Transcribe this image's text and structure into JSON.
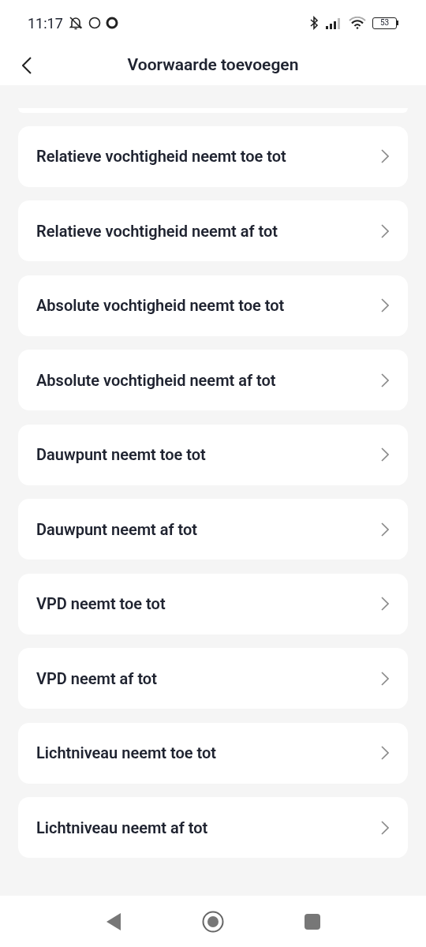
{
  "status_bar": {
    "time": "11:17",
    "battery": "53"
  },
  "header": {
    "title": "Voorwaarde toevoegen"
  },
  "conditions": [
    {
      "label": "Relatieve vochtigheid neemt toe tot"
    },
    {
      "label": "Relatieve vochtigheid neemt af tot"
    },
    {
      "label": "Absolute vochtigheid neemt toe tot"
    },
    {
      "label": "Absolute vochtigheid neemt af tot"
    },
    {
      "label": "Dauwpunt neemt toe tot"
    },
    {
      "label": "Dauwpunt neemt af tot"
    },
    {
      "label": "VPD neemt toe tot"
    },
    {
      "label": "VPD neemt af tot"
    },
    {
      "label": "Lichtniveau neemt toe tot"
    },
    {
      "label": "Lichtniveau neemt af tot"
    }
  ]
}
